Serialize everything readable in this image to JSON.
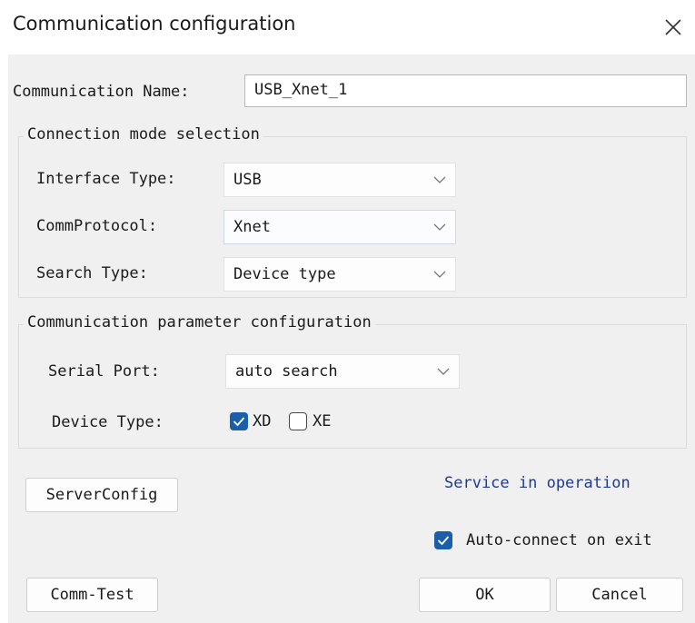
{
  "window": {
    "title": "Communication configuration"
  },
  "form": {
    "name_label": "Communication Name:",
    "name_value": "USB_Xnet_1"
  },
  "connection": {
    "group_label": "Connection mode selection",
    "interface_label": "Interface Type:",
    "interface_value": "USB",
    "protocol_label": "CommProtocol:",
    "protocol_value": "Xnet",
    "search_label": "Search Type:",
    "search_value": "Device type"
  },
  "params": {
    "group_label": "Communication parameter configuration",
    "serial_label": "Serial Port:",
    "serial_value": "auto search",
    "device_label": "Device Type:",
    "device_options": [
      {
        "label": "XD",
        "checked": true
      },
      {
        "label": "XE",
        "checked": false
      }
    ]
  },
  "footer": {
    "server_config_label": "ServerConfig",
    "service_status": "Service in operation",
    "auto_connect_label": "Auto-connect on exit",
    "auto_connect_checked": true,
    "comm_test_label": "Comm-Test",
    "ok_label": "OK",
    "cancel_label": "Cancel"
  },
  "colors": {
    "accent": "#1c5fa9",
    "status_text": "#1f3a93",
    "panel_bg": "#f0f0f0"
  }
}
